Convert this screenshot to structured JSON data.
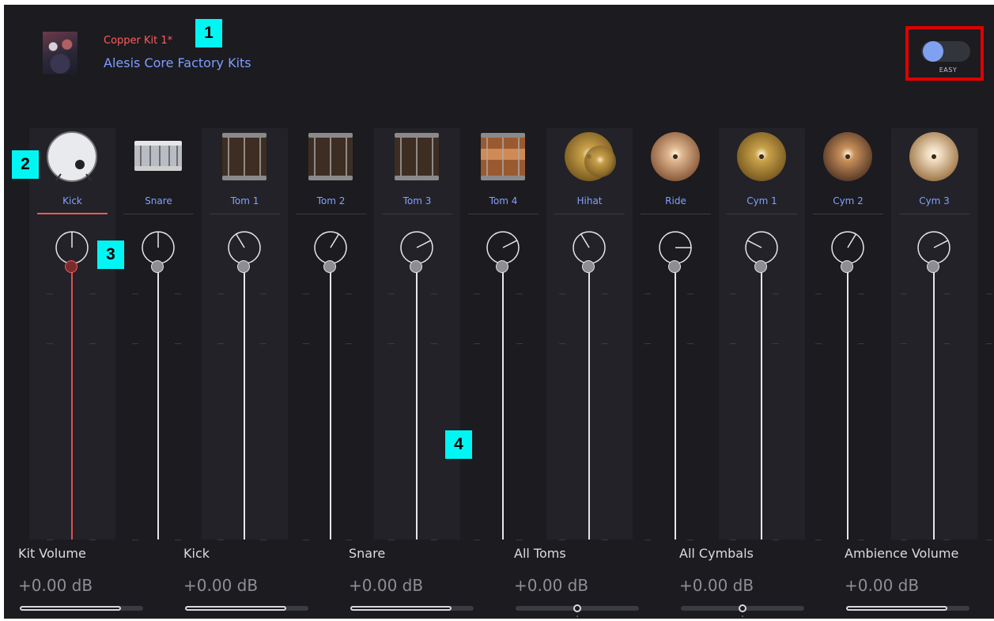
{
  "header": {
    "kit_name": "Copper Kit 1*",
    "kit_library": "Alesis Core Factory Kits",
    "mode_label": "EASY"
  },
  "callouts": [
    "1",
    "2",
    "3",
    "4"
  ],
  "channels": [
    {
      "label": "Kick",
      "type": "kick",
      "pan": 0,
      "level": 0.81,
      "active": true
    },
    {
      "label": "Snare",
      "type": "snare",
      "pan": 0,
      "level": 0.81,
      "active": false
    },
    {
      "label": "Tom 1",
      "type": "tom",
      "pan": -0.35,
      "level": 0.81,
      "active": false
    },
    {
      "label": "Tom 2",
      "type": "tom",
      "pan": 0.35,
      "level": 0.81,
      "active": false
    },
    {
      "label": "Tom 3",
      "type": "tom",
      "pan": 0.7,
      "level": 0.81,
      "active": false
    },
    {
      "label": "Tom 4",
      "type": "tom-copper",
      "pan": 0.7,
      "level": 0.81,
      "active": false
    },
    {
      "label": "Hihat",
      "type": "cymbal-hihat",
      "pan": -0.35,
      "level": 0.81,
      "active": false
    },
    {
      "label": "Ride",
      "type": "cymbal-ride",
      "pan": 1.0,
      "level": 0.81,
      "active": false
    },
    {
      "label": "Cym 1",
      "type": "cymbal",
      "pan": -0.7,
      "level": 0.81,
      "active": false
    },
    {
      "label": "Cym 2",
      "type": "cymbal-china",
      "pan": 0.35,
      "level": 0.81,
      "active": false
    },
    {
      "label": "Cym 3",
      "type": "cymbal-bright",
      "pan": 0.7,
      "level": 0.81,
      "active": false
    }
  ],
  "groups": [
    {
      "label": "Kit Volume",
      "value": "+0.00 dB",
      "style": "fill",
      "level": 0.82
    },
    {
      "label": "Kick",
      "value": "+0.00 dB",
      "style": "fill",
      "level": 0.82
    },
    {
      "label": "Snare",
      "value": "+0.00 dB",
      "style": "fill",
      "level": 0.82
    },
    {
      "label": "All Toms",
      "value": "+0.00 dB",
      "style": "center",
      "level": 0.5
    },
    {
      "label": "All Cymbals",
      "value": "+0.00 dB",
      "style": "center",
      "level": 0.5
    },
    {
      "label": "Ambience Volume",
      "value": "+0.00 dB",
      "style": "fill",
      "level": 0.82
    }
  ],
  "colors": {
    "accent_red": "#f05a5a",
    "label_blue": "#83a0ff",
    "kit_name_red": "#ff5d5d",
    "toggle_knob": "#7fa1f0",
    "callout_cyan": "#00f6f2"
  }
}
